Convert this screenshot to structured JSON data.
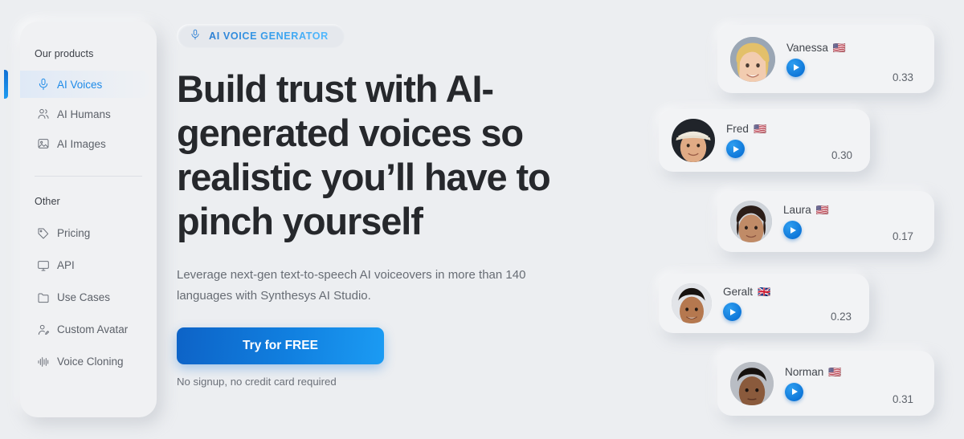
{
  "sidebar": {
    "products_title": "Our products",
    "other_title": "Other",
    "products": [
      {
        "label": "AI Voices",
        "icon": "microphone-icon",
        "active": true
      },
      {
        "label": "AI Humans",
        "icon": "users-icon",
        "active": false
      },
      {
        "label": "AI Images",
        "icon": "image-icon",
        "active": false
      }
    ],
    "other": [
      {
        "label": "Pricing",
        "icon": "tag-icon"
      },
      {
        "label": "API",
        "icon": "monitor-icon"
      },
      {
        "label": "Use Cases",
        "icon": "folder-icon"
      },
      {
        "label": "Custom Avatar",
        "icon": "user-edit-icon"
      },
      {
        "label": "Voice Cloning",
        "icon": "waveform-icon"
      }
    ]
  },
  "hero": {
    "badge_label": "AI VOICE GENERATOR",
    "badge_icon": "microphone-icon",
    "headline": "Build trust with AI-generated voices so realistic you’ll have to pinch yourself",
    "subtitle": "Leverage next-gen text-to-speech AI voiceovers in more than 140 languages with Synthesys AI Studio.",
    "cta_label": "Try for FREE",
    "cta_note": "No signup, no credit card required"
  },
  "voice_cards": [
    {
      "name": "Vanessa",
      "flag": "🇺🇸",
      "score": "0.33",
      "play_icon": "play-icon"
    },
    {
      "name": "Fred",
      "flag": "🇺🇸",
      "score": "0.30",
      "play_icon": "play-icon"
    },
    {
      "name": "Laura",
      "flag": "🇺🇸",
      "score": "0.17",
      "play_icon": "play-icon"
    },
    {
      "name": "Geralt",
      "flag": "🇬🇧",
      "score": "0.23",
      "play_icon": "play-icon"
    },
    {
      "name": "Norman",
      "flag": "🇺🇸",
      "score": "0.31",
      "play_icon": "play-icon"
    }
  ],
  "colors": {
    "accent_blue": "#1d8ae8",
    "cta_gradient_start": "#0d63c7",
    "cta_gradient_end": "#1b9bf3",
    "page_background": "#eceef1",
    "heading_text": "#26282c"
  }
}
